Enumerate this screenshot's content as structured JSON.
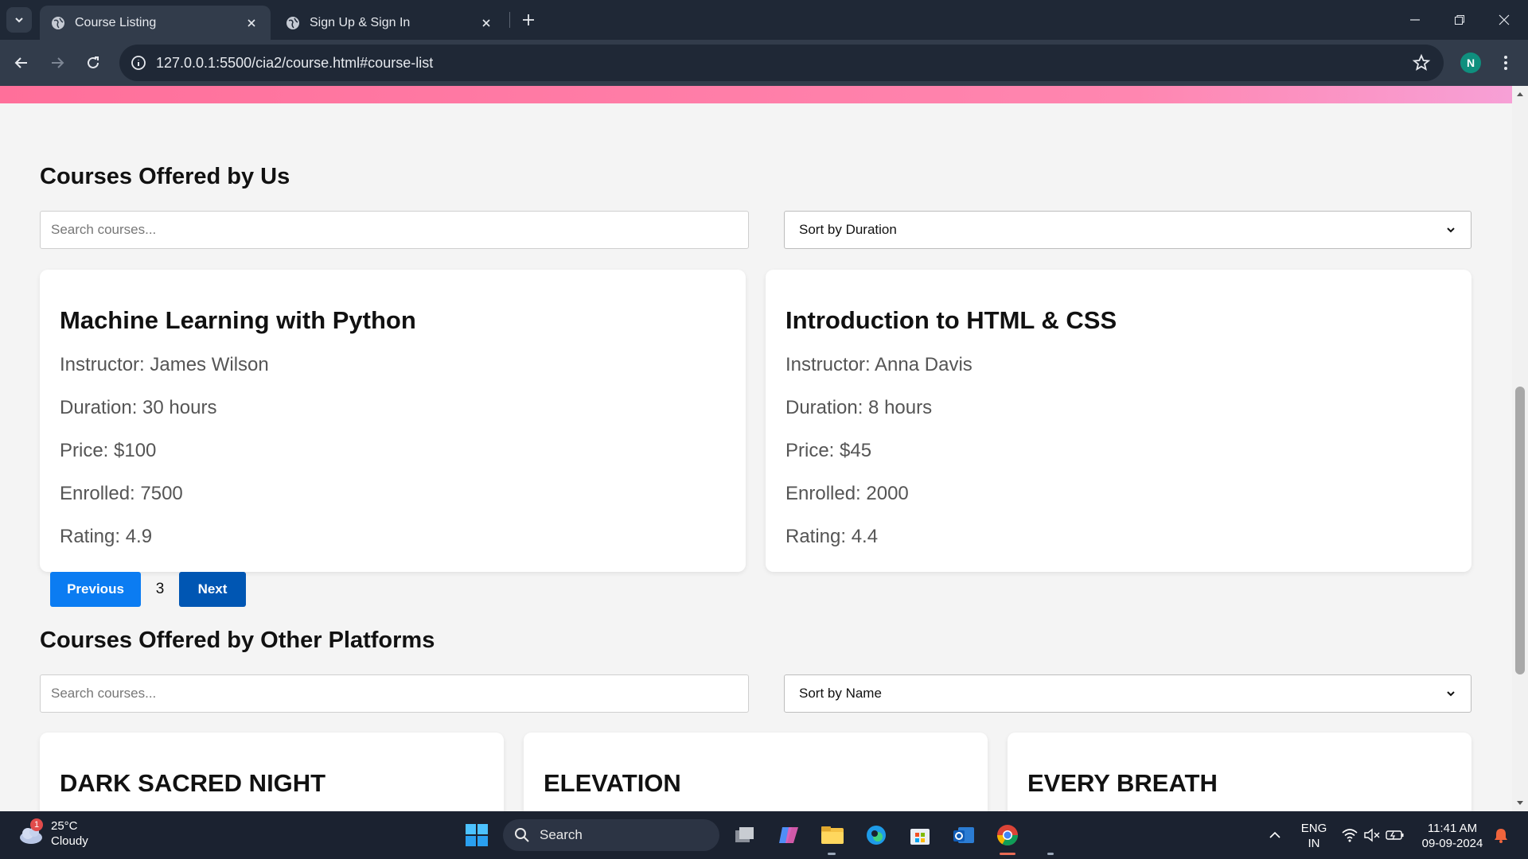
{
  "browser": {
    "tabs": [
      {
        "title": "Course Listing",
        "active": true
      },
      {
        "title": "Sign Up & Sign In",
        "active": false
      }
    ],
    "url": "127.0.0.1:5500/cia2/course.html#course-list",
    "profile_initial": "N"
  },
  "our_courses": {
    "title": "Courses Offered by Us",
    "search_placeholder": "Search courses...",
    "sort_selected": "Sort by Duration",
    "cards": [
      {
        "title": "Machine Learning with Python",
        "instructor": "Instructor: James Wilson",
        "duration": "Duration: 30 hours",
        "price": "Price: $100",
        "enrolled": "Enrolled: 7500",
        "rating": "Rating: 4.9"
      },
      {
        "title": "Introduction to HTML & CSS",
        "instructor": "Instructor: Anna Davis",
        "duration": "Duration: 8 hours",
        "price": "Price: $45",
        "enrolled": "Enrolled: 2000",
        "rating": "Rating: 4.4"
      }
    ],
    "pagination": {
      "previous_label": "Previous",
      "current_page": "3",
      "next_label": "Next"
    }
  },
  "other_courses": {
    "title": "Courses Offered by Other Platforms",
    "search_placeholder": "Search courses...",
    "sort_selected": "Sort by Name",
    "cards": [
      {
        "title": "DARK SACRED NIGHT"
      },
      {
        "title": "ELEVATION"
      },
      {
        "title": "EVERY BREATH"
      }
    ]
  },
  "taskbar": {
    "weather_temp": "25°C",
    "weather_desc": "Cloudy",
    "weather_badge": "1",
    "search_label": "Search",
    "language_line1": "ENG",
    "language_line2": "IN",
    "time": "11:41 AM",
    "date": "09-09-2024"
  },
  "colors": {
    "primary_button": "#0b7cf2",
    "next_button": "#0056b3",
    "gradient_start": "#ff6f9a",
    "gradient_end": "#f7a0d6"
  }
}
